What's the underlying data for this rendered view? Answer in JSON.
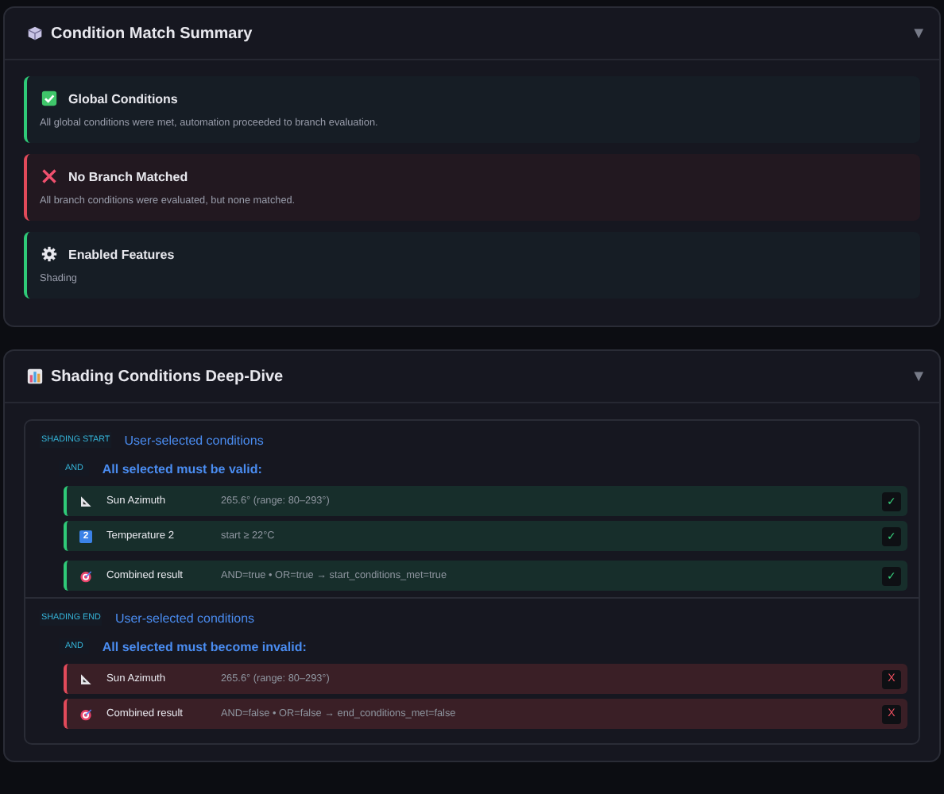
{
  "summary": {
    "title": "Condition Match Summary",
    "toggle": "▼",
    "items": [
      {
        "passed": true,
        "kind": "check",
        "title": "Global Conditions",
        "text": "All global conditions were met, automation proceeded to branch evaluation."
      },
      {
        "passed": false,
        "kind": "cross",
        "title": "No Branch Matched",
        "text": "All branch conditions were evaluated, but none matched."
      },
      {
        "passed": true,
        "kind": "gear",
        "title": "Enabled Features",
        "text": "Shading"
      }
    ]
  },
  "deep_dive": {
    "title": "Shading Conditions Deep-Dive",
    "toggle": "▼",
    "groups": [
      {
        "tag": "SHADING START",
        "heading": "User-selected conditions",
        "operator": "AND",
        "rule": "All selected must be valid:",
        "rows": [
          {
            "passed": true,
            "kind": "angle",
            "name": "Sun Azimuth",
            "detail": "265.6° (range: 80–293°)",
            "mark": "✓"
          },
          {
            "passed": true,
            "kind": "keycap",
            "icon_label": "2",
            "name": "Temperature 2",
            "detail": "start ≥ 22°C",
            "mark": "✓"
          },
          {
            "passed": true,
            "kind": "combined",
            "name": "Combined result",
            "detail": "AND=true • OR=true → start_conditions_met=true",
            "mark": "✓"
          }
        ]
      },
      {
        "tag": "SHADING END",
        "heading": "User-selected conditions",
        "operator": "AND",
        "rule": "All selected must become invalid:",
        "rows": [
          {
            "passed": false,
            "kind": "angle",
            "name": "Sun Azimuth",
            "detail": "265.6° (range: 80–293°)",
            "mark": "X"
          },
          {
            "passed": false,
            "kind": "combined",
            "name": "Combined result",
            "detail": "AND=false • OR=false → end_conditions_met=false",
            "mark": "X"
          }
        ]
      }
    ]
  }
}
